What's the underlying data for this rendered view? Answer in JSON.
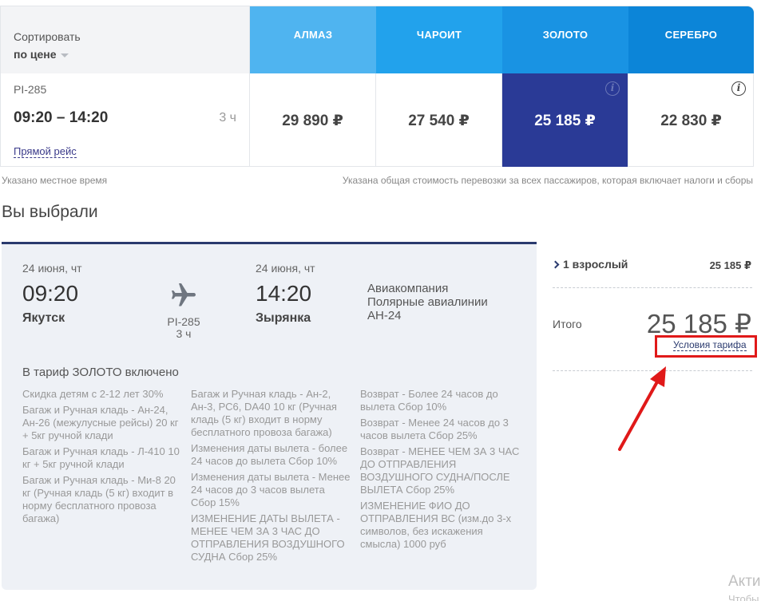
{
  "sort": {
    "label": "Сортировать",
    "value": "по цене"
  },
  "tariffs": [
    {
      "name": "АЛМАЗ",
      "price": "29 890 ₽"
    },
    {
      "name": "ЧАРОИТ",
      "price": "27 540 ₽"
    },
    {
      "name": "ЗОЛОТО",
      "price": "25 185 ₽"
    },
    {
      "name": "СЕРЕБРО",
      "price": "22 830 ₽"
    }
  ],
  "flight": {
    "number": "PI-285",
    "time": "09:20 – 14:20",
    "duration": "3 ч",
    "direct_label": "Прямой рейс"
  },
  "notes": {
    "local_time": "Указано местное время",
    "total_cost": "Указана общая стоимость перевозки за всех пассажиров, которая включает налоги и сборы"
  },
  "section_title": "Вы выбрали",
  "card": {
    "dep_date": "24 июня, чт",
    "dep_time": "09:20",
    "dep_city": "Якутск",
    "flight_no": "PI-285",
    "duration": "3 ч",
    "arr_date": "24 июня, чт",
    "arr_time": "14:20",
    "arr_city": "Зырянка",
    "airline_line1": "Авиакомпания",
    "airline_line2": "Полярные авиалинии",
    "aircraft": "АН-24",
    "included_title": "В тариф ЗОЛОТО включено",
    "col1": [
      "Скидка детям с 2-12 лет 30%",
      "Багаж и Ручная кладь - Ан-24, Ан-26 (межулусные рейсы) 20 кг + 5кг ручной клади",
      "Багаж и Ручная кладь - Л-410 10 кг + 5кг ручной клади",
      "Багаж и Ручная кладь - Ми-8 20 кг (Ручная кладь (5 кг) входит в норму бесплатного провоза багажа)"
    ],
    "col2": [
      "Багаж и Ручная кладь - Ан-2, Ан-3, РС6, DA40 10 кг (Ручная кладь (5 кг) входит в норму бесплатного провоза багажа)",
      "Изменения даты вылета - более 24 часов до вылета Сбор 10%",
      "Изменения даты вылета - Менее 24 часов до 3 часов вылета Сбор 15%",
      "ИЗМЕНЕНИЕ ДАТЫ ВЫЛЕТА - МЕНЕЕ ЧЕМ ЗА 3 ЧАС ДО ОТПРАВЛЕНИЯ ВОЗДУШНОГО СУДНА Сбор 25%"
    ],
    "col3": [
      "Возврат - Более 24 часов до вылета Сбор 10%",
      "Возврат - Менее 24 часов до 3 часов вылета Сбор 25%",
      "Возврат - МЕНЕЕ ЧЕМ ЗА 3 ЧАС ДО ОТПРАВЛЕНИЯ ВОЗДУШНОГО СУДНА/ПОСЛЕ ВЫЛЕТА Сбор 25%",
      "ИЗМЕНЕНИЕ ФИО ДО ОТПРАВЛЕНИЯ ВС (изм.до 3-х символов, без искажения смысла) 1000 руб"
    ]
  },
  "summary": {
    "passengers": "1 взрослый",
    "passengers_price": "25 185 ₽",
    "total_label": "Итого",
    "total": "25 185 ₽",
    "tariff_link": "Условия тарифа"
  },
  "watermark": {
    "line1": "Акти",
    "line2": "Чтобы"
  },
  "colors": {
    "accent": "#2a3a96",
    "highlight": "#e01919",
    "header_blue": "#1993e3"
  }
}
